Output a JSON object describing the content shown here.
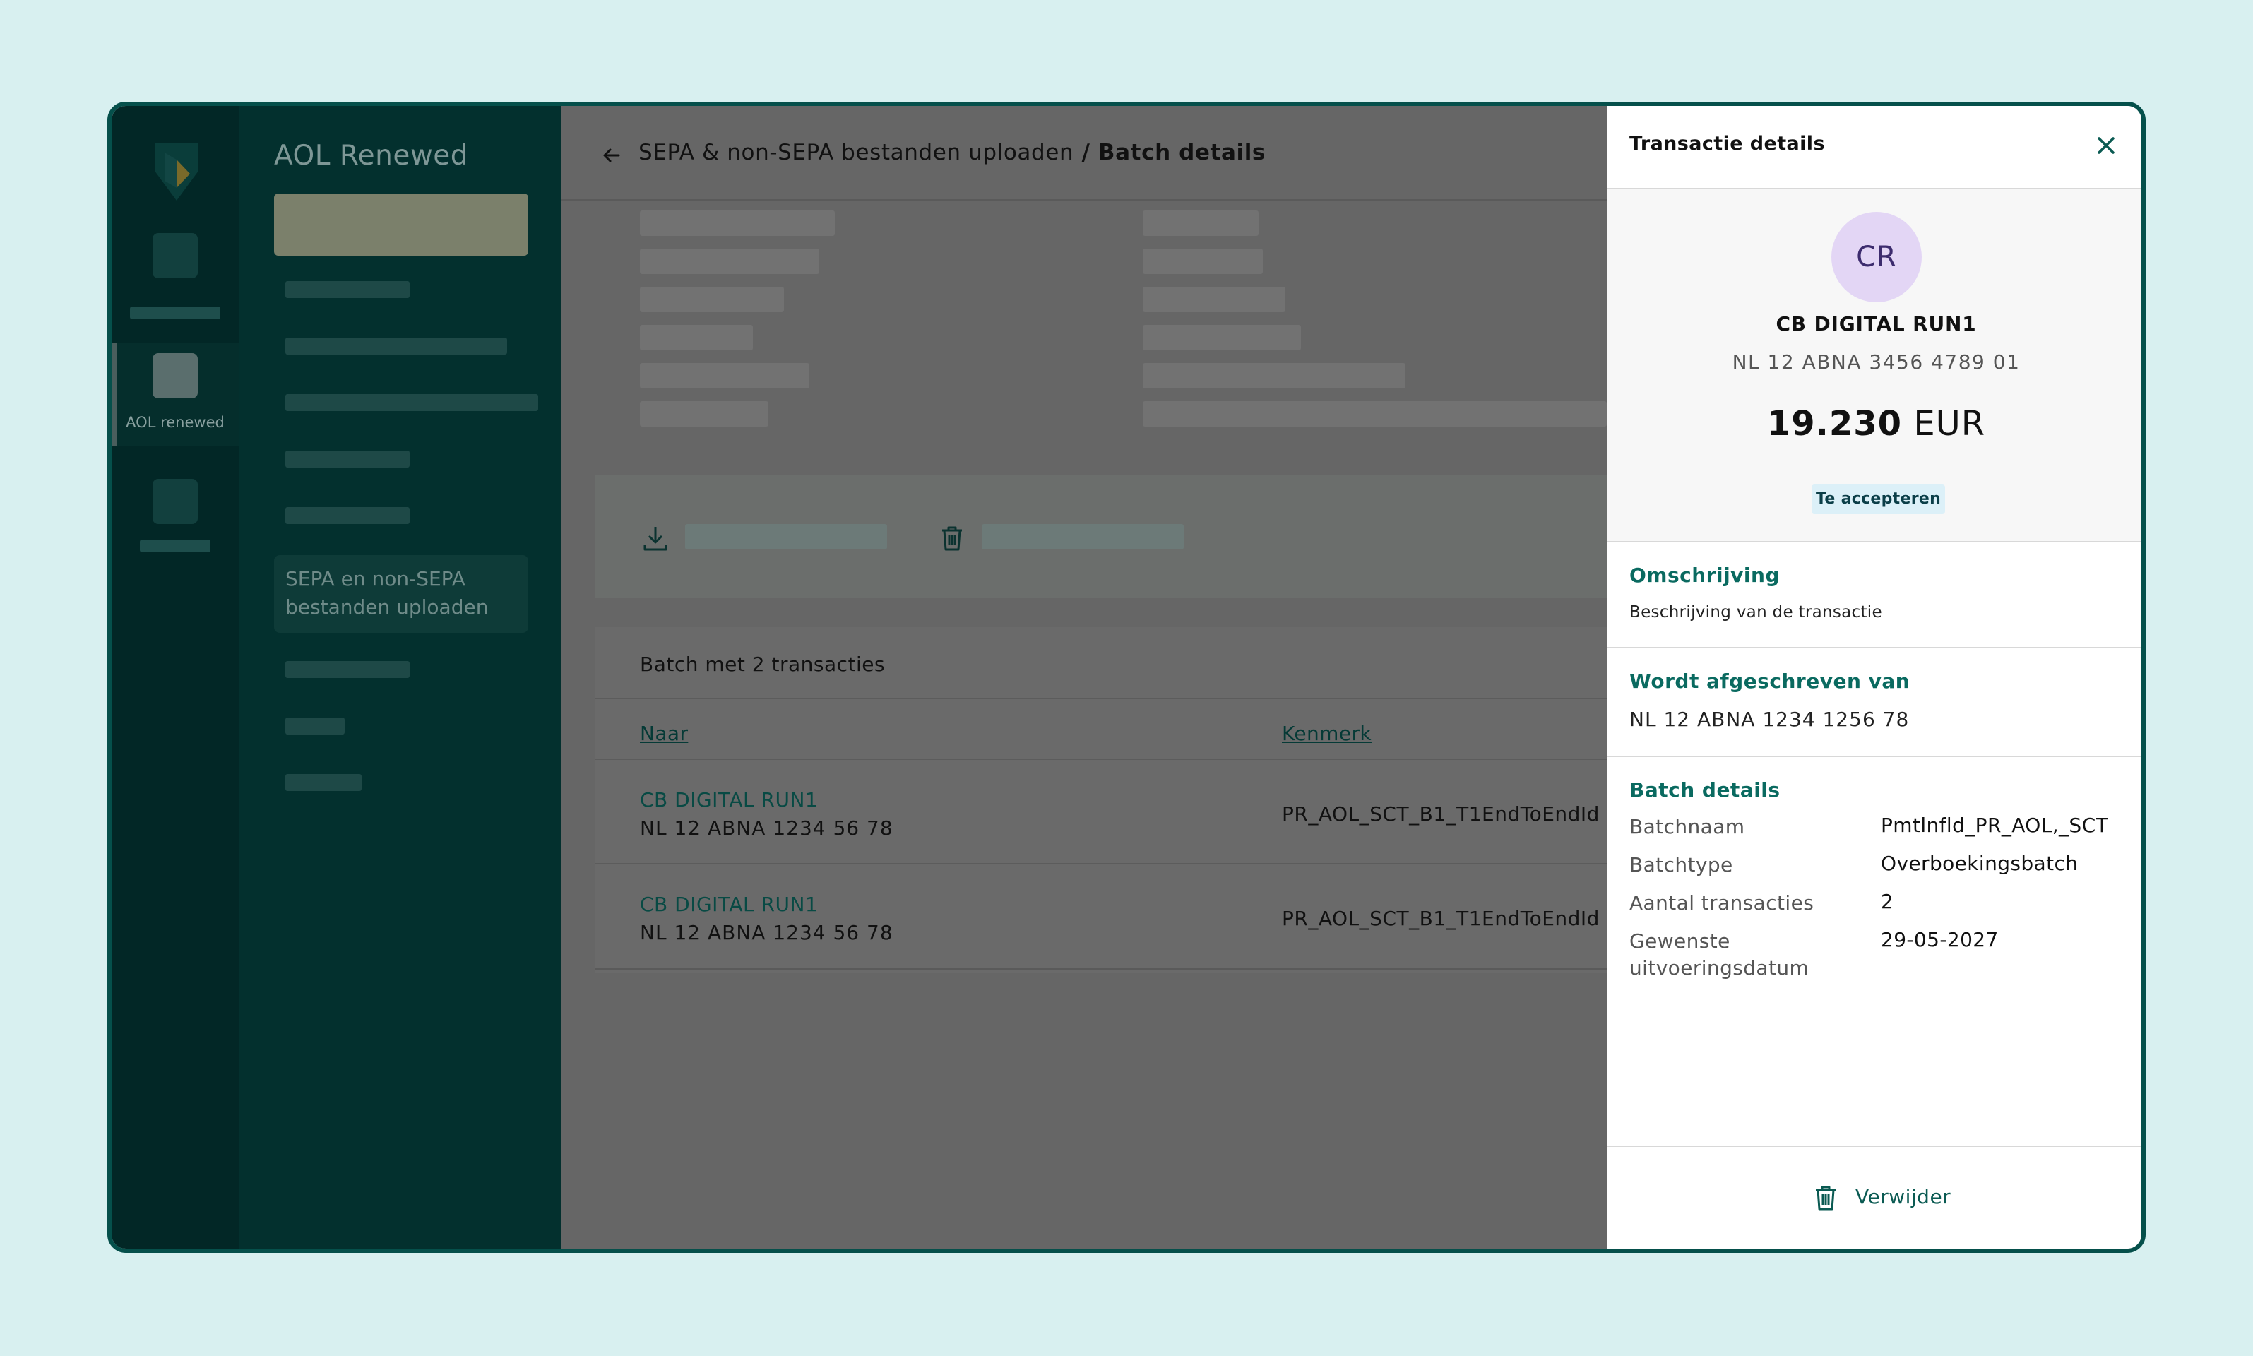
{
  "sidebar": {
    "app_title": "AOL Renewed",
    "active_item_label": "SEPA en non-SEPA bestanden uploaden"
  },
  "rail": {
    "active_label": "AOL renewed"
  },
  "header": {
    "breadcrumb_parent": "SEPA & non-SEPA bestanden uploaden",
    "breadcrumb_separator": " / ",
    "breadcrumb_current": "Batch details"
  },
  "batch": {
    "title": "Batch met 2 transacties",
    "columns": {
      "to": "Naar",
      "reference": "Kenmerk"
    },
    "rows": [
      {
        "name": "CB DIGITAL RUN1",
        "iban": "NL 12 ABNA 1234 56 78",
        "reference": "PR_AOL_SCT_B1_T1EndToEndId"
      },
      {
        "name": "CB DIGITAL RUN1",
        "iban": "NL 12 ABNA 1234 56 78",
        "reference": "PR_AOL_SCT_B1_T1EndToEndId"
      }
    ]
  },
  "drawer": {
    "title": "Transactie details",
    "avatar_initials": "CR",
    "counterparty_name": "CB DIGITAL RUN1",
    "counterparty_iban": "NL 12 ABNA 3456 4789 01",
    "amount": "19.230",
    "currency": "EUR",
    "status": "Te accepteren",
    "description_title": "Omschrijving",
    "description_text": "Beschrijving van de transactie",
    "debit_title": "Wordt afgeschreven van",
    "debit_iban": "NL 12 ABNA 1234 1256 78",
    "batch_title": "Batch details",
    "batch_details": [
      {
        "label": "Batchnaam",
        "value": "Pmtlnfld_PR_AOL,_SCT"
      },
      {
        "label": "Batchtype",
        "value": "Overboekingsbatch"
      },
      {
        "label": "Aantal transacties",
        "value": "2"
      },
      {
        "label": "Gewenste uitvoeringsdatum",
        "value": "29-05-2027"
      }
    ],
    "delete_label": "Verwijder"
  },
  "colors": {
    "brand_teal": "#05504b",
    "accent_green": "#0a6a60",
    "badge_bg": "#dcf0f8",
    "avatar_bg": "#e3d6f5"
  }
}
